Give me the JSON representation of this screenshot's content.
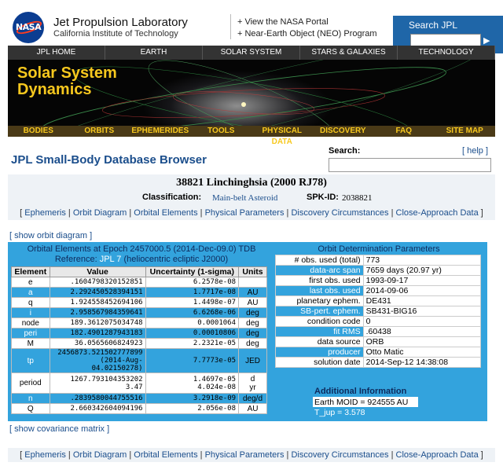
{
  "header": {
    "logo_text": "NASA",
    "lab_title": "Jet Propulsion Laboratory",
    "lab_subtitle": "California Institute of Technology",
    "links": [
      "+ View the NASA Portal",
      "+ Near-Earth Object (NEO) Program"
    ],
    "search_label": "Search JPL",
    "search_go": "▶"
  },
  "top_nav": [
    "JPL HOME",
    "EARTH",
    "SOLAR SYSTEM",
    "STARS & GALAXIES",
    "TECHNOLOGY"
  ],
  "banner": {
    "title_line1": "Solar System",
    "title_line2": "Dynamics"
  },
  "sub_nav": [
    "BODIES",
    "ORBITS",
    "EPHEMERIDES",
    "TOOLS",
    "PHYSICAL DATA",
    "DISCOVERY",
    "FAQ",
    "SITE MAP"
  ],
  "browser": {
    "title": "JPL Small-Body Database Browser",
    "search_label": "Search:",
    "help": "[ help ]"
  },
  "object": {
    "name": "38821 Linchinghsia (2000 RJ78)",
    "classification_label": "Classification:",
    "classification_value": "Main-belt Asteroid",
    "spk_label": "SPK-ID:",
    "spk_value": "2038821"
  },
  "section_links": [
    "Ephemeris",
    "Orbit Diagram",
    "Orbital Elements",
    "Physical Parameters",
    "Discovery Circumstances",
    "Close-Approach Data"
  ],
  "show_orbit": "[ show orbit diagram ]",
  "show_covariance": "[ show covariance matrix ]",
  "orbital_elements": {
    "title_line1": "Orbital Elements at Epoch 2457000.5 (2014-Dec-09.0) TDB",
    "reference_prefix": "Reference:",
    "reference_jpl": "JPL 7",
    "reference_suffix": "(heliocentric ecliptic J2000)",
    "headers": [
      "Element",
      "Value",
      "Uncertainty (1-sigma)",
      "Units"
    ],
    "rows": [
      {
        "el": "e",
        "val": ".1604798320152851",
        "unc": "6.2578e-08",
        "unit": ""
      },
      {
        "el": "a",
        "val": "2.292450528394151",
        "unc": "1.7717e-08",
        "unit": "AU"
      },
      {
        "el": "q",
        "val": "1.924558452694106",
        "unc": "1.4498e-07",
        "unit": "AU"
      },
      {
        "el": "i",
        "val": "2.958567984359641",
        "unc": "6.6268e-06",
        "unit": "deg"
      },
      {
        "el": "node",
        "val": "189.3612075034748",
        "unc": "0.0001064",
        "unit": "deg"
      },
      {
        "el": "peri",
        "val": "182.4901287943183",
        "unc": "0.00010806",
        "unit": "deg"
      },
      {
        "el": "M",
        "val": "36.0565606824923",
        "unc": "2.2321e-05",
        "unit": "deg"
      },
      {
        "el": "tp",
        "val": "2456873.521502777899",
        "val2": "(2014-Aug-04.02150278)",
        "unc": "7.7773e-05",
        "unit": "JED"
      },
      {
        "el": "period",
        "val": "1267.793104353202",
        "val2": "3.47",
        "unc": "1.4697e-05",
        "unc2": "4.024e-08",
        "unit": "d",
        "unit2": "yr"
      },
      {
        "el": "n",
        "val": ".2839580044755516",
        "unc": "3.2918e-09",
        "unit": "deg/d"
      },
      {
        "el": "Q",
        "val": "2.660342604094196",
        "unc": "2.056e-08",
        "unit": "AU"
      }
    ]
  },
  "orbit_determination": {
    "title": "Orbit Determination Parameters",
    "rows": [
      {
        "k": "# obs. used (total)",
        "v": "773"
      },
      {
        "k": "data-arc span",
        "v": "7659 days (20.97 yr)"
      },
      {
        "k": "first obs. used",
        "v": "1993-09-17"
      },
      {
        "k": "last obs. used",
        "v": "2014-09-06"
      },
      {
        "k": "planetary ephem.",
        "v": "DE431"
      },
      {
        "k": "SB-pert. ephem.",
        "v": "SB431-BIG16"
      },
      {
        "k": "condition code",
        "v": "0"
      },
      {
        "k": "fit RMS",
        "v": ".60438"
      },
      {
        "k": "data source",
        "v": "ORB"
      },
      {
        "k": "producer",
        "v": "Otto Matic"
      },
      {
        "k": "solution date",
        "v": "2014-Sep-12 14:38:08"
      }
    ]
  },
  "additional_info": {
    "title": "Additional Information",
    "rows": [
      "Earth MOID =  924555 AU",
      "T_jup = 3.578"
    ]
  }
}
